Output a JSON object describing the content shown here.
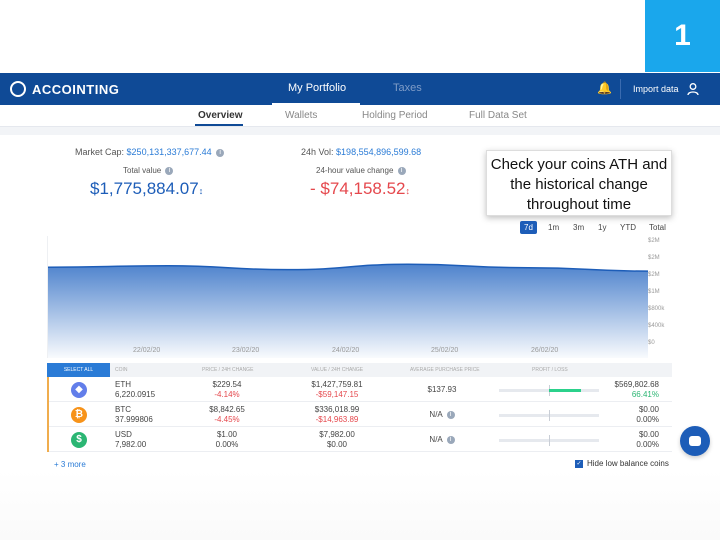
{
  "step_badge": "1",
  "app": {
    "logo": "ACCOINTING"
  },
  "topnav": {
    "portfolio": "My Portfolio",
    "taxes": "Taxes",
    "import": "Import data"
  },
  "subnav": {
    "overview": "Overview",
    "wallets": "Wallets",
    "holding": "Holding Period",
    "full": "Full Data Set"
  },
  "stats": {
    "market_cap_label": "Market Cap:",
    "market_cap_value": "$250,131,337,677.44",
    "vol_label": "24h Vol:",
    "vol_value": "$198,554,896,599.68",
    "total_value_label": "Total value",
    "total_value": "$1,775,884.07",
    "change_label": "24-hour value change",
    "change_sign": "-",
    "change_value": "$74,158.52"
  },
  "tooltip": "Check your coins ATH and the historical change throughout time",
  "ranges": [
    "7d",
    "1m",
    "3m",
    "1y",
    "YTD",
    "Total"
  ],
  "chart_data": {
    "type": "area",
    "x": [
      "22/02/20",
      "23/02/20",
      "24/02/20",
      "25/02/20",
      "26/02/20"
    ],
    "series": [
      {
        "values": [
          1.86,
          1.89,
          1.81,
          1.92,
          1.85,
          1.78
        ]
      }
    ],
    "yticks": [
      "$2M",
      "$2M",
      "$2M",
      "$1M",
      "$800k",
      "$400k",
      "$0"
    ],
    "ylim": [
      0,
      2.2
    ]
  },
  "table": {
    "select_all": "SELECT ALL",
    "headers": [
      "COIN",
      "PRICE / 24H CHANGE",
      "VALUE / 24H CHANGE",
      "AVERAGE PURCHASE PRICE",
      "PROFIT / LOSS"
    ],
    "rows": [
      {
        "symbol": "ETH",
        "amount": "6,220.0915",
        "price": "$229.54",
        "price_change": "-4.14%",
        "value": "$1,427,759.81",
        "value_change": "-$59,147.15",
        "avg": "$137.93",
        "profit": "$569,802.68",
        "profit_pct": "66.41%"
      },
      {
        "symbol": "BTC",
        "amount": "37.999806",
        "price": "$8,842.65",
        "price_change": "-4.45%",
        "value": "$336,018.99",
        "value_change": "-$14,963.89",
        "avg": "N/A",
        "profit": "$0.00",
        "profit_pct": "0.00%"
      },
      {
        "symbol": "USD",
        "amount": "7,982.00",
        "price": "$1.00",
        "price_change": "0.00%",
        "value": "$7,982.00",
        "value_change": "$0.00",
        "avg": "N/A",
        "profit": "$0.00",
        "profit_pct": "0.00%"
      }
    ]
  },
  "footer": {
    "more": "+ 3 more",
    "hide_low": "Hide low balance coins"
  },
  "colors": {
    "brand": "#0f4a96",
    "accent": "#1aa7ec",
    "negative": "#e5484d",
    "positive": "#2bb673"
  }
}
